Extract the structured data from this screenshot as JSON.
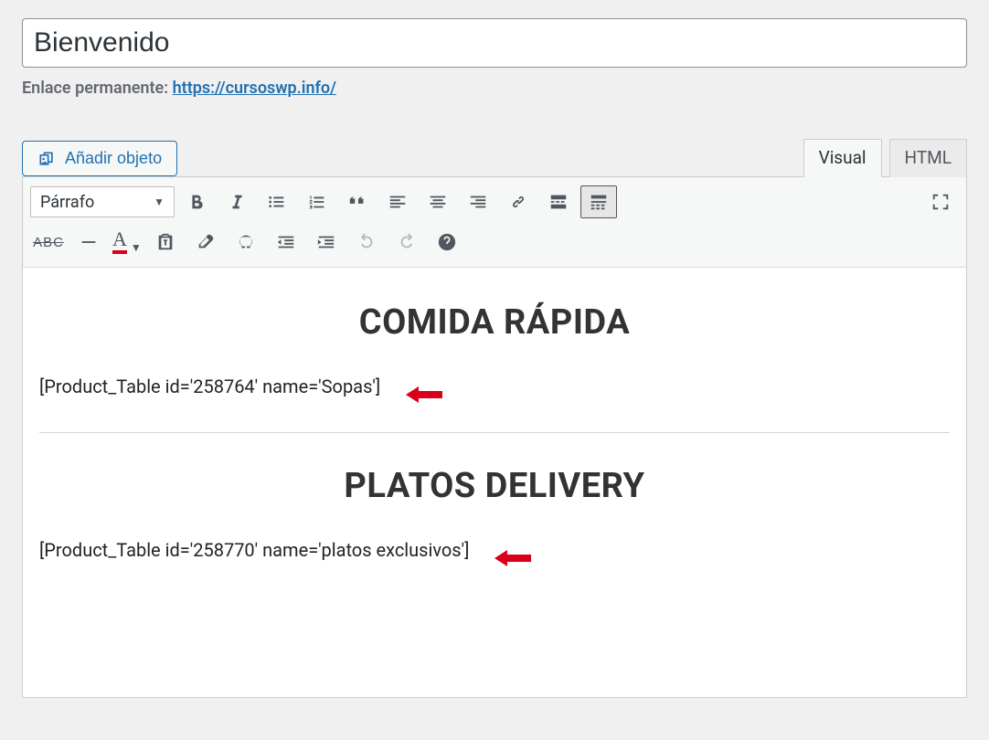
{
  "title": "Bienvenido",
  "permalink": {
    "label": "Enlace permanente:",
    "url": "https://cursoswp.info/"
  },
  "media_button_label": "Añadir objeto",
  "tabs": {
    "visual": "Visual",
    "html": "HTML"
  },
  "format_select": "Párrafo",
  "content": {
    "heading1": "COMIDA RÁPIDA",
    "shortcode1": "[Product_Table id='258764' name='Sopas']",
    "heading2": "PLATOS DELIVERY",
    "shortcode2": "[Product_Table id='258770' name='platos exclusivos']"
  }
}
